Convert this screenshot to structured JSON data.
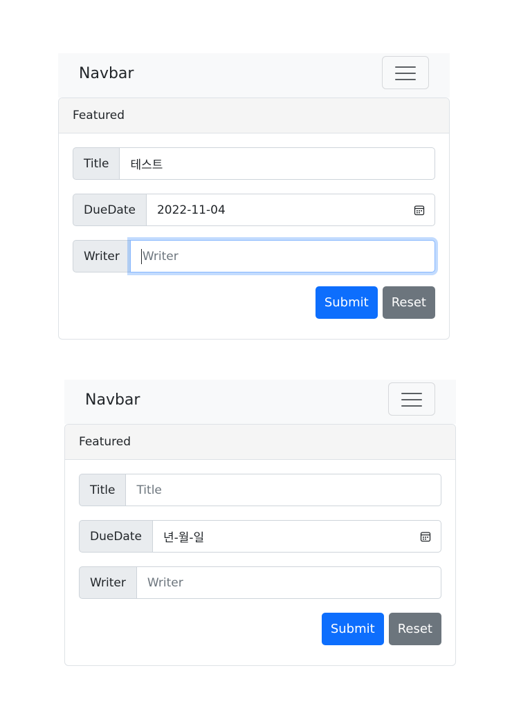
{
  "colors": {
    "navbar_bg": "#f8f9fa",
    "primary": "#0d6efd",
    "secondary": "#6c757d",
    "focus_ring": "#86b7fe"
  },
  "panels": [
    {
      "navbar": {
        "brand": "Navbar",
        "toggler_icon": "hamburger-icon"
      },
      "card": {
        "header": "Featured",
        "fields": {
          "title": {
            "label": "Title",
            "value": "테스트",
            "placeholder": "Title"
          },
          "duedate": {
            "label": "DueDate",
            "value": "2022-11-04",
            "icon": "calendar-icon"
          },
          "writer": {
            "label": "Writer",
            "value": "",
            "placeholder": "Writer",
            "focused": true
          }
        },
        "buttons": {
          "submit": "Submit",
          "reset": "Reset"
        }
      }
    },
    {
      "navbar": {
        "brand": "Navbar",
        "toggler_icon": "hamburger-icon"
      },
      "card": {
        "header": "Featured",
        "fields": {
          "title": {
            "label": "Title",
            "value": "",
            "placeholder": "Title"
          },
          "duedate": {
            "label": "DueDate",
            "value": "년-월-일",
            "icon": "calendar-icon"
          },
          "writer": {
            "label": "Writer",
            "value": "",
            "placeholder": "Writer",
            "focused": false
          }
        },
        "buttons": {
          "submit": "Submit",
          "reset": "Reset"
        }
      }
    }
  ]
}
